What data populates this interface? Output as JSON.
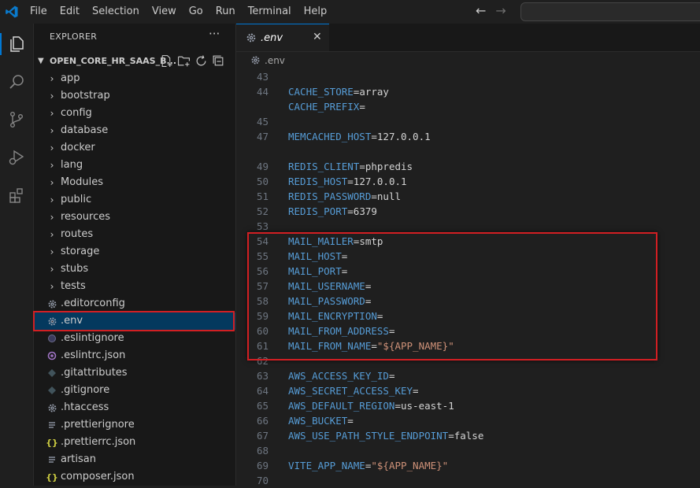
{
  "menu": [
    "File",
    "Edit",
    "Selection",
    "View",
    "Go",
    "Run",
    "Terminal",
    "Help"
  ],
  "explorer": {
    "title": "EXPLORER",
    "more": "···",
    "project": "OPEN_CORE_HR_SAAS_B...",
    "items": [
      {
        "label": "app",
        "type": "folder"
      },
      {
        "label": "bootstrap",
        "type": "folder"
      },
      {
        "label": "config",
        "type": "folder"
      },
      {
        "label": "database",
        "type": "folder"
      },
      {
        "label": "docker",
        "type": "folder"
      },
      {
        "label": "lang",
        "type": "folder"
      },
      {
        "label": "Modules",
        "type": "folder"
      },
      {
        "label": "public",
        "type": "folder"
      },
      {
        "label": "resources",
        "type": "folder"
      },
      {
        "label": "routes",
        "type": "folder"
      },
      {
        "label": "storage",
        "type": "folder"
      },
      {
        "label": "stubs",
        "type": "folder"
      },
      {
        "label": "tests",
        "type": "folder"
      },
      {
        "label": ".editorconfig",
        "type": "gear"
      },
      {
        "label": ".env",
        "type": "gear"
      },
      {
        "label": ".eslintignore",
        "type": "dot"
      },
      {
        "label": ".eslintrc.json",
        "type": "eslint"
      },
      {
        "label": ".gitattributes",
        "type": "diamond"
      },
      {
        "label": ".gitignore",
        "type": "diamond"
      },
      {
        "label": ".htaccess",
        "type": "gear"
      },
      {
        "label": ".prettierignore",
        "type": "lines"
      },
      {
        "label": ".prettierrc.json",
        "type": "braces"
      },
      {
        "label": "artisan",
        "type": "lines"
      },
      {
        "label": "composer.json",
        "type": "braces"
      }
    ]
  },
  "tab": {
    "label": ".env",
    "close": "✕"
  },
  "breadcrumb": ".env",
  "code_lines": [
    {
      "n": "43",
      "key": "",
      "val": "",
      "str": false
    },
    {
      "n": "44",
      "key": "CACHE_STORE",
      "val": "array",
      "str": false
    },
    {
      "n": "",
      "key": "CACHE_PREFIX",
      "val": "",
      "str": false
    },
    {
      "n": "45",
      "key": "",
      "val": "",
      "str": false
    },
    {
      "n": "47",
      "key": "MEMCACHED_HOST",
      "val": "127.0.0.1",
      "str": false
    },
    {
      "n": "",
      "key": "",
      "val": "",
      "str": false
    },
    {
      "n": "49",
      "key": "REDIS_CLIENT",
      "val": "phpredis",
      "str": false
    },
    {
      "n": "50",
      "key": "REDIS_HOST",
      "val": "127.0.0.1",
      "str": false
    },
    {
      "n": "51",
      "key": "REDIS_PASSWORD",
      "val": "null",
      "str": false
    },
    {
      "n": "52",
      "key": "REDIS_PORT",
      "val": "6379",
      "str": false
    },
    {
      "n": "53",
      "key": "",
      "val": "",
      "str": false
    },
    {
      "n": "54",
      "key": "MAIL_MAILER",
      "val": "smtp",
      "str": false
    },
    {
      "n": "55",
      "key": "MAIL_HOST",
      "val": "",
      "str": false
    },
    {
      "n": "56",
      "key": "MAIL_PORT",
      "val": "",
      "str": false
    },
    {
      "n": "57",
      "key": "MAIL_USERNAME",
      "val": "",
      "str": false
    },
    {
      "n": "58",
      "key": "MAIL_PASSWORD",
      "val": "",
      "str": false
    },
    {
      "n": "59",
      "key": "MAIL_ENCRYPTION",
      "val": "",
      "str": false
    },
    {
      "n": "60",
      "key": "MAIL_FROM_ADDRESS",
      "val": "",
      "str": false
    },
    {
      "n": "61",
      "key": "MAIL_FROM_NAME",
      "val": "\"${APP_NAME}\"",
      "str": true
    },
    {
      "n": "62",
      "key": "",
      "val": "",
      "str": false
    },
    {
      "n": "63",
      "key": "AWS_ACCESS_KEY_ID",
      "val": "",
      "str": false
    },
    {
      "n": "64",
      "key": "AWS_SECRET_ACCESS_KEY",
      "val": "",
      "str": false
    },
    {
      "n": "65",
      "key": "AWS_DEFAULT_REGION",
      "val": "us-east-1",
      "str": false
    },
    {
      "n": "66",
      "key": "AWS_BUCKET",
      "val": "",
      "str": false
    },
    {
      "n": "67",
      "key": "AWS_USE_PATH_STYLE_ENDPOINT",
      "val": "false",
      "str": false
    },
    {
      "n": "68",
      "key": "",
      "val": "",
      "str": false
    },
    {
      "n": "69",
      "key": "VITE_APP_NAME",
      "val": "\"${APP_NAME}\"",
      "str": true
    },
    {
      "n": "70",
      "key": "",
      "val": "",
      "str": false
    }
  ],
  "icons": {
    "logo": "vscode-logo-icon",
    "explorer": "files-icon",
    "search": "search-icon",
    "source_control": "source-control-icon",
    "run_debug": "run-debug-icon",
    "extensions": "extensions-icon"
  },
  "colors": {
    "accent": "#0078d4",
    "highlight": "#d21f23",
    "key": "#569cd6",
    "string": "#ce9178"
  }
}
